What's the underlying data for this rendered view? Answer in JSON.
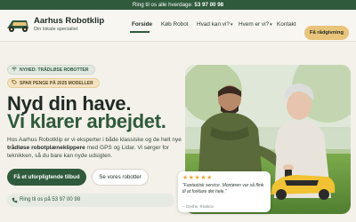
{
  "topbar": {
    "text": "Ring til os alle hverdage:",
    "phone": "53 97 00 98"
  },
  "brand": {
    "name": "Aarhus Robotklip",
    "tagline": "Din lokale specialist",
    "logo_icon": "robot-mower-logo-icon"
  },
  "nav": [
    {
      "label": "Forside",
      "active": true
    },
    {
      "label": "Køb Robot",
      "active": false
    },
    {
      "label": "Hvad kan vi?",
      "active": false,
      "dropdown": true
    },
    {
      "label": "Hvem er vi?",
      "active": false,
      "dropdown": true
    },
    {
      "label": "Kontakt",
      "active": false
    }
  ],
  "cta_top": "Få rådgivning",
  "badges": [
    {
      "icon": "wifi-icon",
      "text": "NYHED: TRÅDLØSE ROBOTTER"
    },
    {
      "icon": "tag-icon",
      "text": "SPAR PENGE PÅ 2025 MODELLER"
    }
  ],
  "hero": {
    "title_line1": "Nyd din have.",
    "title_line2": "Vi klarer arbejdet.",
    "para_pre": "Hos Aarhus Robotklip er vi eksperter i både klassiske og de helt nye ",
    "para_bold": "trådløse robotplæneklippere",
    "para_post": " med GPS og Lidar. Vi sørger for teknikken, så du bare kan nyde udsigten.",
    "btn_primary": "Få et uforpligtende tilbud",
    "btn_secondary": "Se vores robotter",
    "ring_label": "Ring til os på 53 97 00 98"
  },
  "review": {
    "stars": "★★★★★",
    "quote": "\"Fantastisk service. Montøren var så flink til at forklare det hele.\"",
    "author": "– Grethe, Risskov"
  },
  "colors": {
    "brand_green": "#2f5a3c",
    "accent_gold": "#e9c47a",
    "background": "#f3f1ea"
  }
}
